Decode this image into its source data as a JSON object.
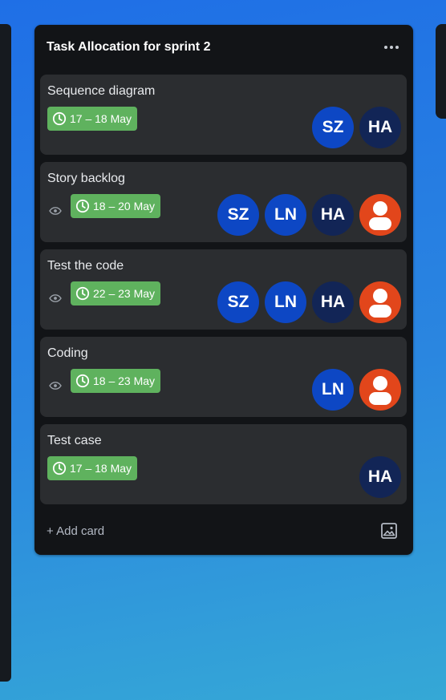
{
  "colors": {
    "list_bg": "#121417",
    "card_bg": "#2b2d30",
    "date_badge": "#5fb25e",
    "avatar_blue": "#0d47c4",
    "avatar_navy": "#122556",
    "avatar_red": "#e2461b"
  },
  "list": {
    "title": "Task Allocation for sprint 2",
    "menu_icon": "more-horizontal-icon",
    "add_card_label": "+ Add card",
    "template_icon": "image-template-icon"
  },
  "cards": [
    {
      "title": "Sequence diagram",
      "date": "17 – 18 May",
      "watched": false,
      "members": [
        "SZ",
        "HA"
      ]
    },
    {
      "title": "Story backlog",
      "date": "18 – 20 May",
      "watched": true,
      "members": [
        "SZ",
        "LN",
        "HA",
        "user-icon"
      ]
    },
    {
      "title": "Test the code",
      "date": "22 – 23 May",
      "watched": true,
      "members": [
        "SZ",
        "LN",
        "HA",
        "user-icon"
      ]
    },
    {
      "title": "Coding",
      "date": "18 – 23 May",
      "watched": true,
      "members": [
        "LN",
        "user-icon"
      ]
    },
    {
      "title": "Test case",
      "date": "17 – 18 May",
      "watched": false,
      "members": [
        "HA"
      ]
    }
  ]
}
